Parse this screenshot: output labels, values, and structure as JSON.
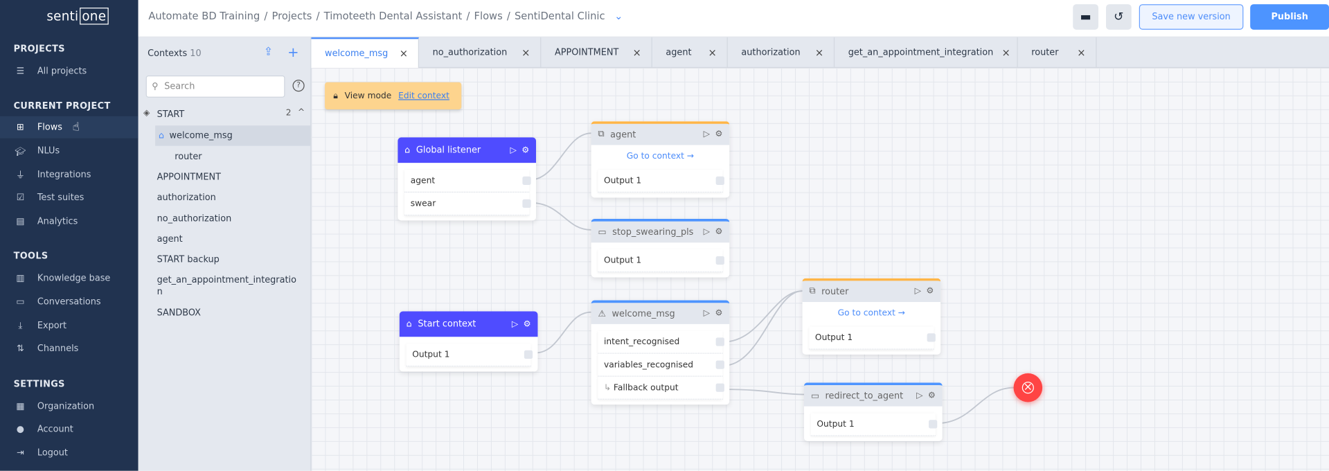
{
  "brand": {
    "logo_text_left": "senti",
    "logo_text_right": "one"
  },
  "sidebar": {
    "sections": [
      {
        "title": "PROJECTS",
        "items": [
          {
            "label": "All projects",
            "icon": "list-icon"
          }
        ]
      },
      {
        "title": "CURRENT PROJECT",
        "items": [
          {
            "label": "Flows",
            "icon": "flows-icon",
            "active": true
          },
          {
            "label": "NLUs",
            "icon": "graduation-cap-icon"
          },
          {
            "label": "Integrations",
            "icon": "plug-icon"
          },
          {
            "label": "Test suites",
            "icon": "checklist-icon"
          },
          {
            "label": "Analytics",
            "icon": "chart-icon"
          }
        ]
      },
      {
        "title": "TOOLS",
        "items": [
          {
            "label": "Knowledge base",
            "icon": "book-icon"
          },
          {
            "label": "Conversations",
            "icon": "chat-icon"
          },
          {
            "label": "Export",
            "icon": "download-icon"
          },
          {
            "label": "Channels",
            "icon": "channels-icon"
          }
        ]
      },
      {
        "title": "SETTINGS",
        "items": [
          {
            "label": "Organization",
            "icon": "building-icon"
          },
          {
            "label": "Account",
            "icon": "user-icon"
          },
          {
            "label": "Logout",
            "icon": "logout-icon"
          }
        ]
      }
    ]
  },
  "header": {
    "breadcrumb": [
      "Automate BD Training",
      "Projects",
      "Timoteeth Dental Assistant",
      "Flows",
      "SentiDental Clinic"
    ],
    "save_label": "Save new version",
    "publish_label": "Publish",
    "colors": {
      "primary": "#4d94ff",
      "sidebar": "#213350"
    }
  },
  "contexts": {
    "title": "Contexts",
    "count": "10",
    "search_placeholder": "Search",
    "group": {
      "label": "START",
      "count": "2"
    },
    "group_items": [
      "welcome_msg",
      "router"
    ],
    "items": [
      "APPOINTMENT",
      "authorization",
      "no_authorization",
      "agent",
      "START backup",
      "get_an_appointment_integratio\nn",
      "SANDBOX"
    ]
  },
  "tabs": [
    "welcome_msg",
    "no_authorization",
    "APPOINTMENT",
    "agent",
    "authorization",
    "get_an_appointment_integration",
    "router"
  ],
  "canvas": {
    "view_mode": "View mode",
    "edit_context": "Edit context",
    "nodes": {
      "global": {
        "title": "Global listener",
        "outputs": [
          "agent",
          "swear"
        ]
      },
      "agent": {
        "title": "agent",
        "goto": "Go to context →",
        "outputs": [
          "Output 1"
        ]
      },
      "stop": {
        "title": "stop_swearing_pls",
        "outputs": [
          "Output 1"
        ]
      },
      "start": {
        "title": "Start context",
        "outputs": [
          "Output 1"
        ]
      },
      "welcome": {
        "title": "welcome_msg",
        "outputs": [
          "intent_recognised",
          "variables_recognised",
          "Fallback output"
        ]
      },
      "router": {
        "title": "router",
        "goto": "Go to context →",
        "outputs": [
          "Output 1"
        ]
      },
      "redirect": {
        "title": "redirect_to_agent",
        "outputs": [
          "Output 1"
        ]
      }
    }
  }
}
